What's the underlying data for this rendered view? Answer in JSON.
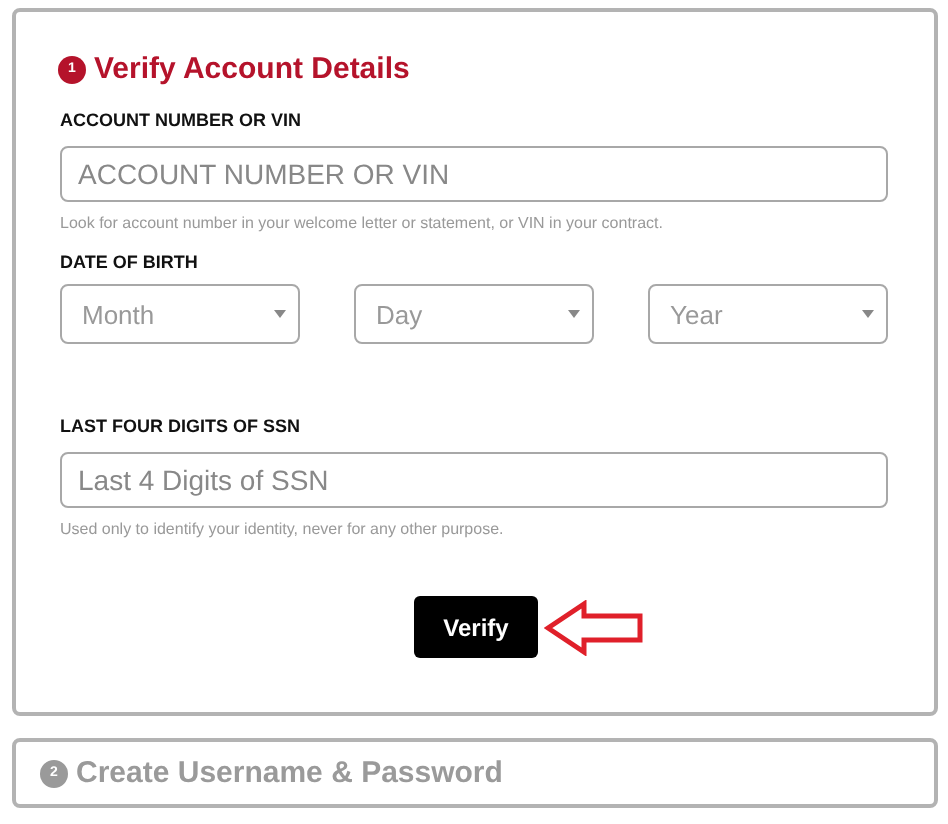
{
  "steps": [
    {
      "number": "1",
      "title": "Verify Account Details",
      "active": true,
      "form": {
        "account": {
          "label": "ACCOUNT NUMBER OR VIN",
          "placeholder": "ACCOUNT NUMBER OR VIN",
          "hint": "Look for account number in your welcome letter or statement, or VIN in your contract."
        },
        "dob": {
          "label": "DATE OF BIRTH",
          "selects": [
            {
              "placeholder": "Month"
            },
            {
              "placeholder": "Day"
            },
            {
              "placeholder": "Year"
            }
          ]
        },
        "ssn": {
          "label": "LAST FOUR DIGITS OF SSN",
          "placeholder": "Last 4 Digits of SSN",
          "hint": "Used only to identify your identity, never for any other purpose."
        },
        "button": "Verify"
      }
    },
    {
      "number": "2",
      "title": "Create Username & Password",
      "active": false
    }
  ]
}
